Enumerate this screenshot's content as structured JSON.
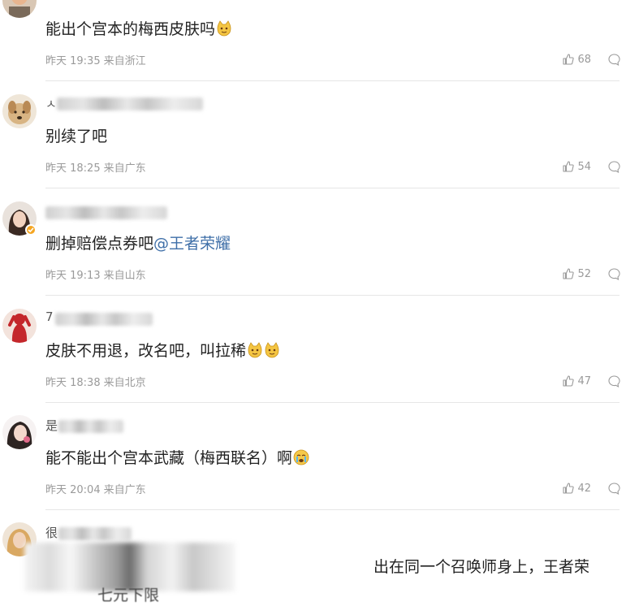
{
  "comments": [
    {
      "text": "能出个宫本的梅西皮肤吗",
      "emoji": [
        "cat-emoji"
      ],
      "time": "昨天 19:35",
      "location": "来自浙江",
      "likes": "68",
      "avatar": "avatar-man"
    },
    {
      "username_lead": "ㅅ",
      "text": "别续了吧",
      "emoji": [],
      "time": "昨天 18:25",
      "location": "来自广东",
      "likes": "54",
      "avatar": "avatar-dog"
    },
    {
      "text_before": "删掉赔偿点券吧",
      "mention": "@王者荣耀",
      "emoji": [],
      "time": "昨天 19:13",
      "location": "来自山东",
      "likes": "52",
      "avatar": "avatar-woman-verified",
      "verified": true
    },
    {
      "username_lead": "7",
      "text": "皮肤不用退，改名吧，叫拉稀",
      "emoji": [
        "cat-emoji",
        "cat-emoji"
      ],
      "time": "昨天 18:38",
      "location": "来自北京",
      "likes": "47",
      "avatar": "avatar-red-figure"
    },
    {
      "username_lead": "是",
      "text": "能不能出个宫本武藏（梅西联名）啊",
      "emoji": [
        "crying-emoji"
      ],
      "time": "昨天 20:04",
      "location": "来自广东",
      "likes": "42",
      "avatar": "avatar-girl"
    },
    {
      "username_lead": "很",
      "avatar": "avatar-blonde"
    }
  ],
  "overlay_text": "出在同一个召唤师身上，王者荣",
  "bottom_text": "七元下限",
  "colors": {
    "mention": "#3f6fa8",
    "meta": "#9a9a9a",
    "divider": "#e6e6e6"
  }
}
